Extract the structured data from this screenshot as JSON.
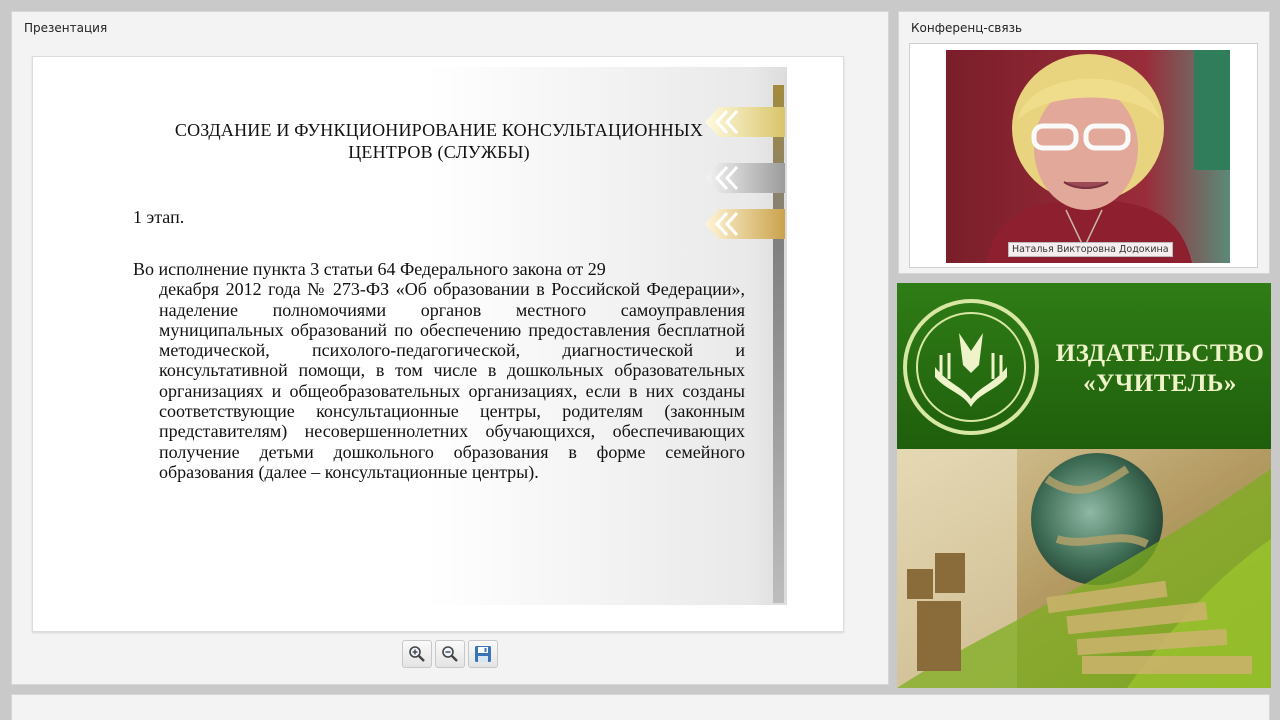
{
  "presentation": {
    "panel_title": "Презентация",
    "slide": {
      "heading": "СОЗДАНИЕ И ФУНКЦИОНИРОВАНИЕ КОНСУЛЬТАЦИОННЫХ ЦЕНТРОВ (СЛУЖБЫ)",
      "stage": "1 этап.",
      "body_first": "Во исполнение пункта 3 статьи 64 Федерального закона от 29",
      "body_rest": "декабря 2012 года № 273-ФЗ «Об образовании в Российской Федерации», наделение полномочиями органов местного самоуправления муниципальных образований по обеспечению предоставления бесплатной методической, психолого-педагогической, диагностической и консультативной помощи, в том числе в дошкольных образовательных организациях и общеобразовательных организациях, если в них созданы соответствующие консультационные центры, родителям (законным представителям) несовершеннолетних обучающихся, обеспечивающих получение детьми дошкольного образования в форме семейного образования (далее – консультационные центры)."
    },
    "toolbar": {
      "icons": [
        "zoom-in-icon",
        "zoom-out-icon",
        "save-icon"
      ]
    }
  },
  "conference": {
    "panel_title": "Конференц-связь",
    "participant_name": "Наталья Викторовна Додокина"
  },
  "banner": {
    "brand_line1": "ИЗДАТЕЛЬСТВО",
    "brand_line2": "«УЧИТЕЛЬ»",
    "colors": {
      "green": "#2f7d16",
      "light": "#eef3c9"
    }
  }
}
